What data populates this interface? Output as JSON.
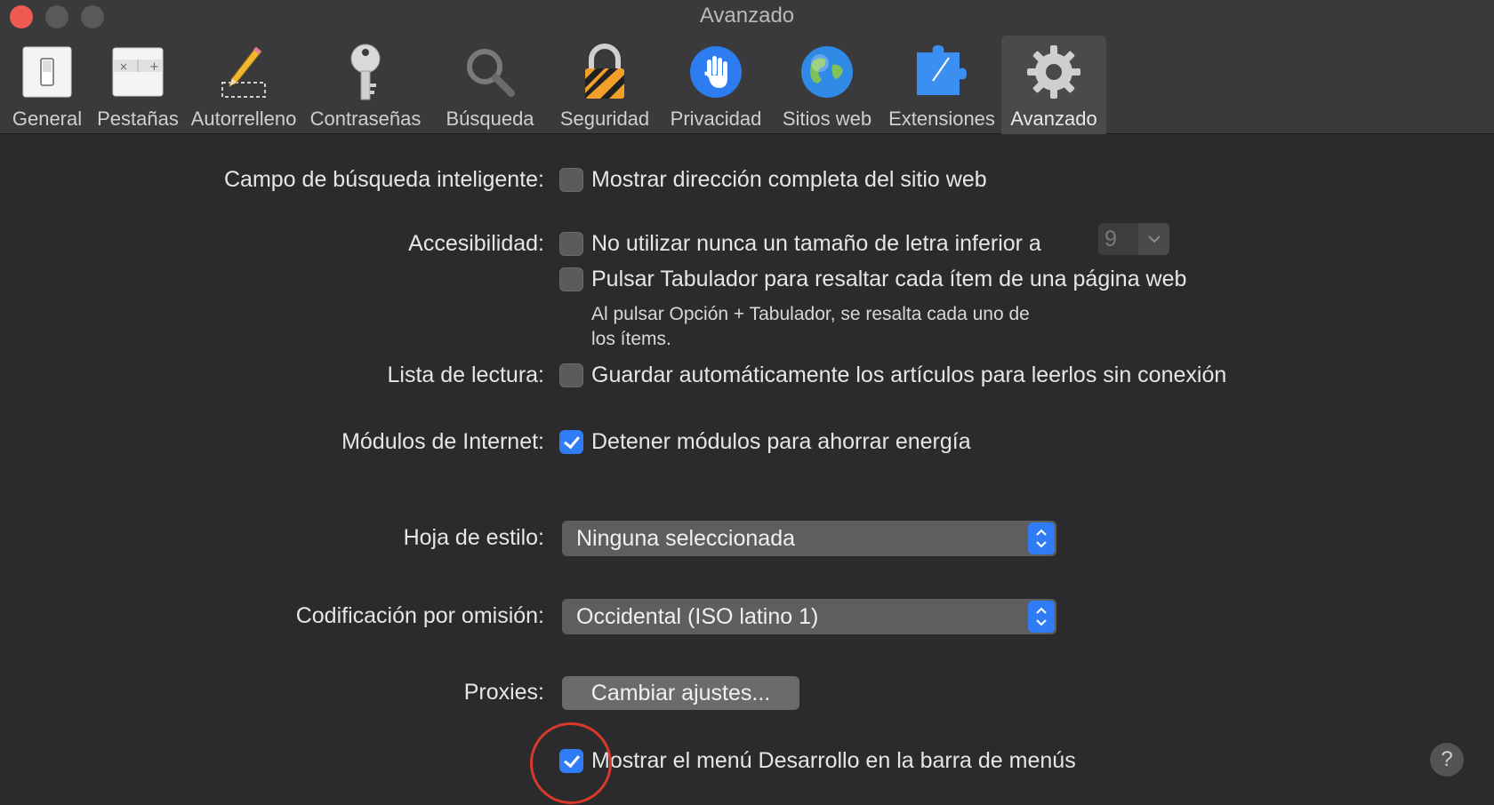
{
  "window": {
    "title": "Avanzado"
  },
  "toolbar": {
    "items": [
      {
        "label": "General",
        "icon": "switch-icon"
      },
      {
        "label": "Pestañas",
        "icon": "tabs-icon"
      },
      {
        "label": "Autorrelleno",
        "icon": "pencil-icon"
      },
      {
        "label": "Contraseñas",
        "icon": "key-icon"
      },
      {
        "label": "Búsqueda",
        "icon": "magnifier-icon"
      },
      {
        "label": "Seguridad",
        "icon": "padlock-icon"
      },
      {
        "label": "Privacidad",
        "icon": "hand-icon"
      },
      {
        "label": "Sitios web",
        "icon": "globe-icon"
      },
      {
        "label": "Extensiones",
        "icon": "puzzle-icon"
      },
      {
        "label": "Avanzado",
        "icon": "gear-icon"
      }
    ],
    "active": "Avanzado"
  },
  "settings": {
    "smart_search": {
      "label": "Campo de búsqueda inteligente:",
      "option": "Mostrar dirección completa del sitio web",
      "checked": false
    },
    "accessibility": {
      "label": "Accesibilidad:",
      "font_option": "No utilizar nunca un tamaño de letra inferior a",
      "font_checked": false,
      "font_size": "9",
      "tab_option": "Pulsar Tabulador para resaltar cada ítem de una página web",
      "tab_checked": false,
      "tab_note_line1": "Al pulsar Opción + Tabulador, se resalta cada uno de",
      "tab_note_line2": "los ítems."
    },
    "reading_list": {
      "label": "Lista de lectura:",
      "option": "Guardar automáticamente los artículos para leerlos sin conexión",
      "checked": false
    },
    "plugins": {
      "label": "Módulos de Internet:",
      "option": "Detener módulos para ahorrar energía",
      "checked": true
    },
    "stylesheet": {
      "label": "Hoja de estilo:",
      "value": "Ninguna seleccionada"
    },
    "encoding": {
      "label": "Codificación por omisión:",
      "value": "Occidental (ISO latino 1)"
    },
    "proxies": {
      "label": "Proxies:",
      "button": "Cambiar ajustes..."
    },
    "develop_menu": {
      "option": "Mostrar el menú Desarrollo en la barra de menús",
      "checked": true
    }
  },
  "help": {
    "label": "?"
  },
  "colors": {
    "accent": "#2f7cf6",
    "annotation": "#d8392b",
    "background": "#2b2b2d"
  }
}
